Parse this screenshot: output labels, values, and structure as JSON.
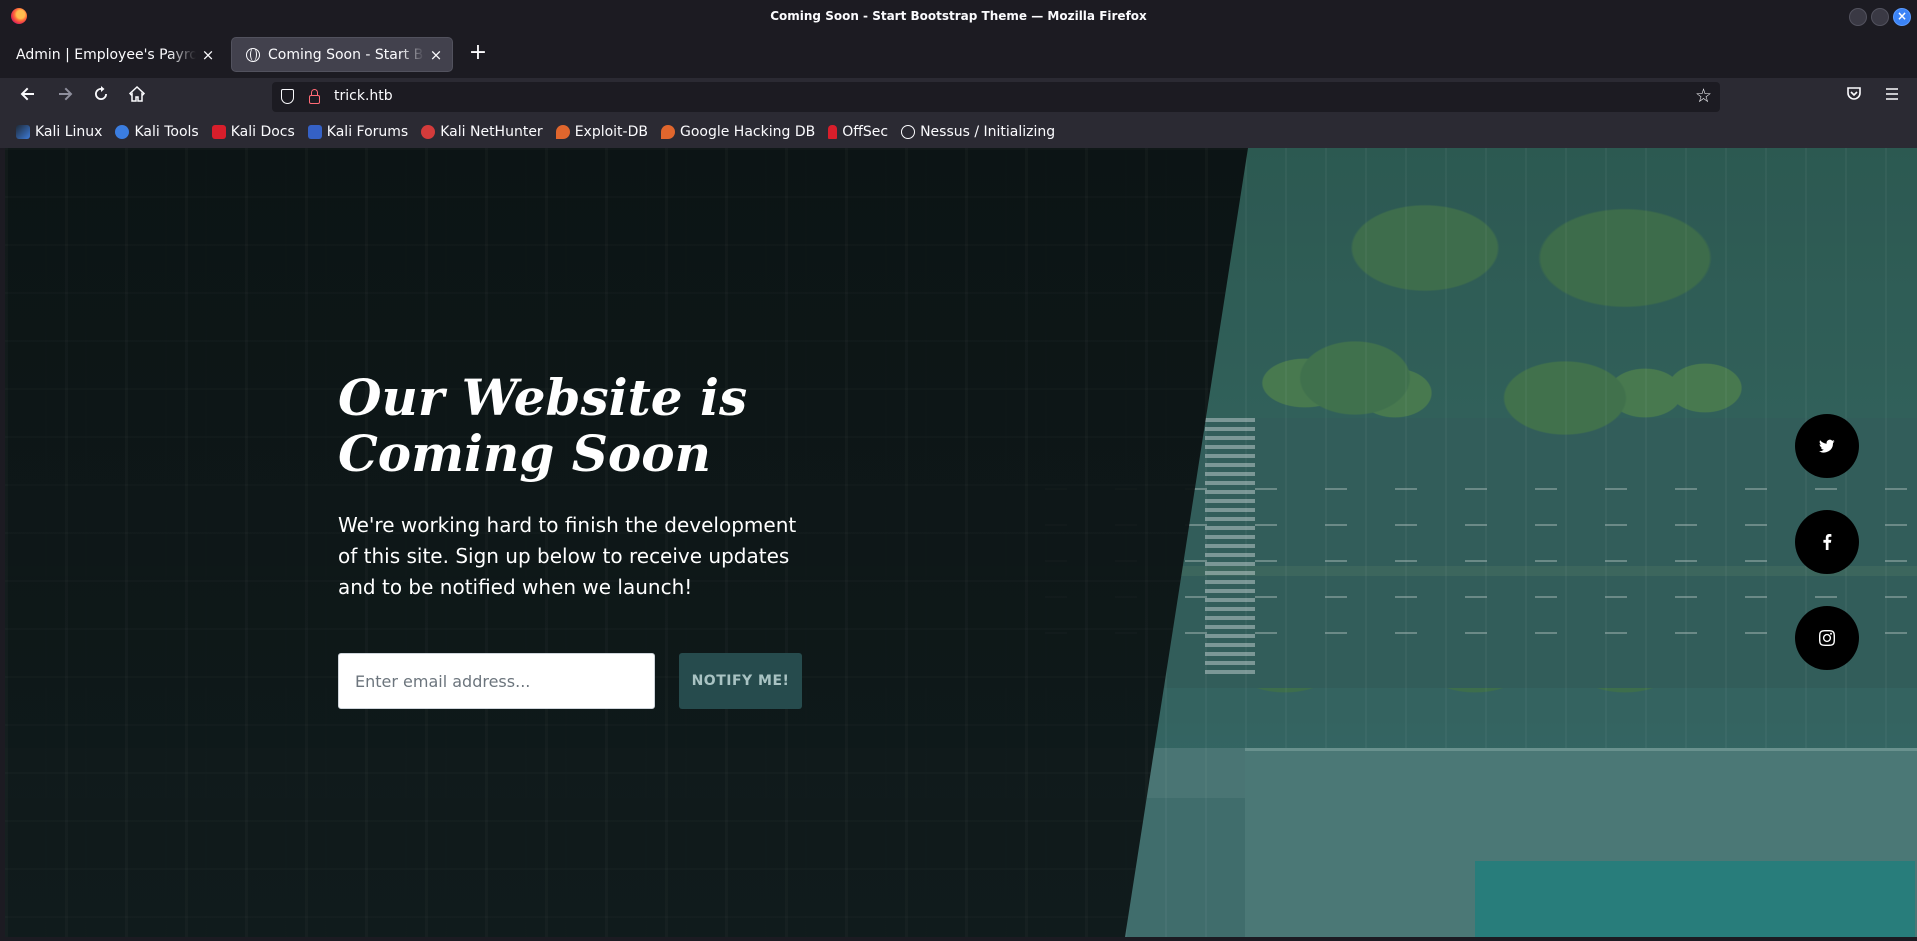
{
  "window": {
    "title": "Coming Soon - Start Bootstrap Theme — Mozilla Firefox"
  },
  "tabs": [
    {
      "label": "Admin | Employee's Payroll Management System",
      "active": false
    },
    {
      "label": "Coming Soon - Start Bootstrap Theme",
      "active": true
    }
  ],
  "toolbar": {
    "back_icon": "arrow-left-icon",
    "forward_icon": "arrow-right-icon",
    "reload_icon": "reload-icon",
    "home_icon": "home-icon",
    "pocket_icon": "pocket-icon",
    "menu_icon": "hamburger-menu-icon"
  },
  "urlbar": {
    "url": "trick.htb"
  },
  "bookmarks": [
    {
      "label": "Kali Linux"
    },
    {
      "label": "Kali Tools"
    },
    {
      "label": "Kali Docs"
    },
    {
      "label": "Kali Forums"
    },
    {
      "label": "Kali NetHunter"
    },
    {
      "label": "Exploit-DB"
    },
    {
      "label": "Google Hacking DB"
    },
    {
      "label": "OffSec"
    },
    {
      "label": "Nessus / Initializing"
    }
  ],
  "page": {
    "headline": "Our Website is Coming Soon",
    "lead": "We're working hard to finish the development of this site. Sign up below to receive updates and to be notified when we launch!",
    "email_placeholder": "Enter email address...",
    "notify_label": "NOTIFY ME!",
    "social": [
      "twitter-icon",
      "facebook-icon",
      "instagram-icon"
    ]
  },
  "colors": {
    "browser_bg": "#1c1b22",
    "toolbar_bg": "#2b2a33",
    "button_bg": "#264b4d",
    "overlay": "#0b1213"
  }
}
